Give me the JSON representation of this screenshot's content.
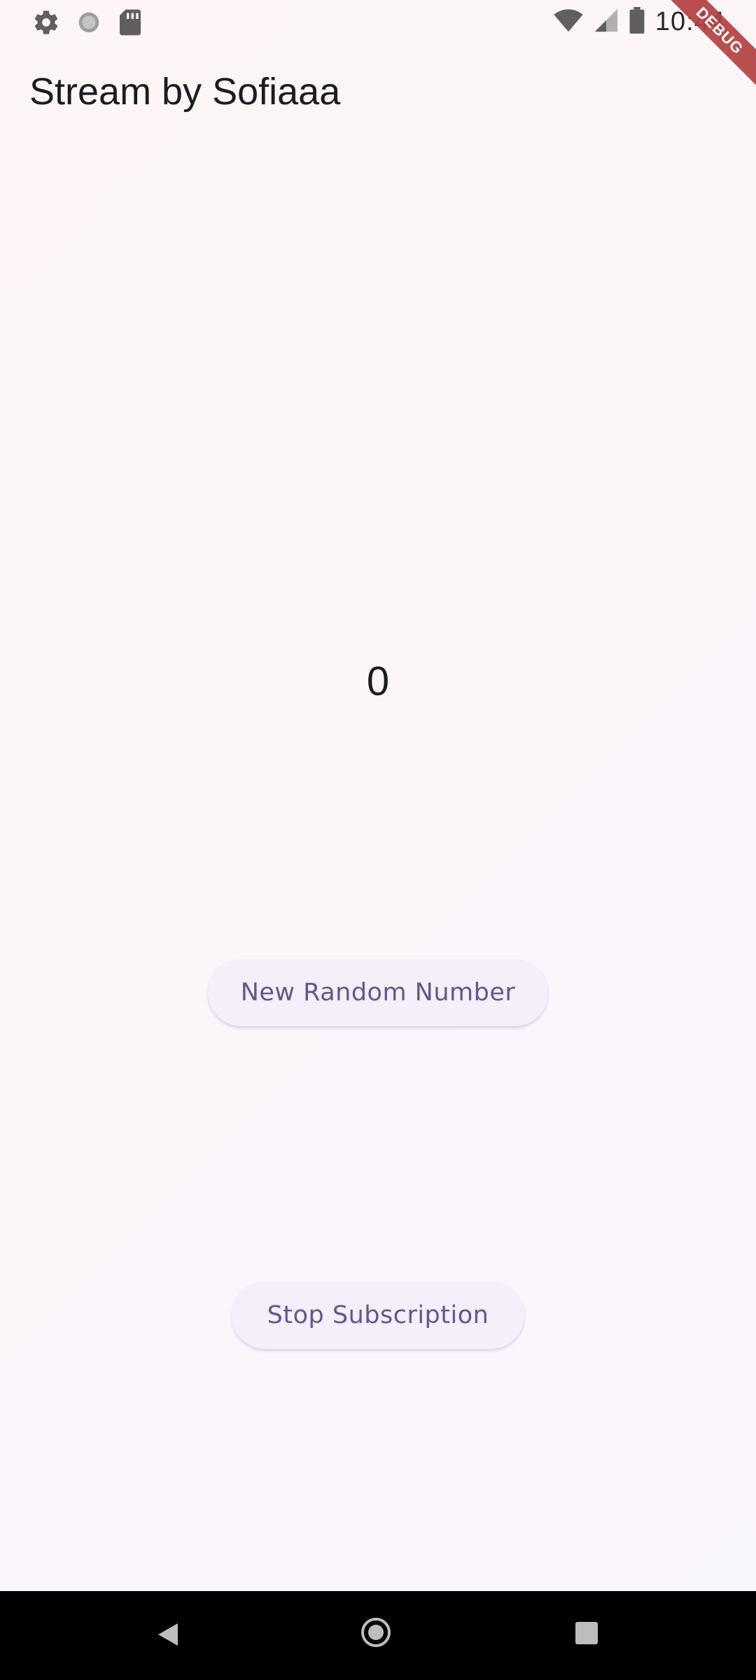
{
  "status_bar": {
    "time": "10:44",
    "left_icons": [
      "gear-icon",
      "circle-icon",
      "sd-card-icon"
    ],
    "right_icons": [
      "wifi-icon",
      "cell-signal-icon",
      "battery-icon"
    ]
  },
  "debug_banner": "DEBUG",
  "app_bar": {
    "title": "Stream by Sofiaaa"
  },
  "main": {
    "number": "0",
    "random_button_label": "New Random Number",
    "stop_button_label": "Stop Subscription"
  },
  "nav_bar": {
    "icons": [
      "back-icon",
      "home-icon",
      "recents-icon"
    ]
  },
  "colors": {
    "accent": "#65558f",
    "button_bg": "#f6eef8",
    "debug_banner": "#b3403f"
  }
}
